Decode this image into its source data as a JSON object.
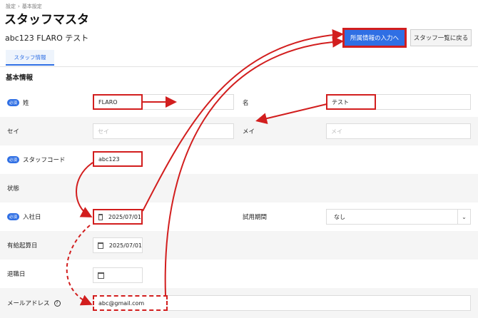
{
  "breadcrumb": {
    "parent": "設定",
    "separator": "›",
    "current": "基本設定"
  },
  "page": {
    "title": "スタッフマスタ",
    "staff_name": "abc123 FLARO テスト"
  },
  "buttons": {
    "to_affiliation": "所属情報の入力へ",
    "back_to_list": "スタッフ一覧に戻る"
  },
  "tabs": [
    {
      "label": "スタッフ情報"
    }
  ],
  "section": {
    "title": "基本情報"
  },
  "required_badge": "必須",
  "form": {
    "last_name": {
      "label": "姓",
      "value": "FLARO"
    },
    "first_name": {
      "label": "名",
      "value": "テスト"
    },
    "last_name_kana": {
      "label": "セイ",
      "placeholder": "セイ"
    },
    "first_name_kana": {
      "label": "メイ",
      "placeholder": "メイ"
    },
    "staff_code": {
      "label": "スタッフコード",
      "value": "abc123"
    },
    "status": {
      "label": "状態"
    },
    "hire_date": {
      "label": "入社日",
      "value": "2025/07/01"
    },
    "trial_period": {
      "label": "試用期間",
      "value": "なし"
    },
    "paid_leave_start": {
      "label": "有給起算日",
      "value": "2025/07/01"
    },
    "retire_date": {
      "label": "退職日",
      "value": ""
    },
    "email": {
      "label": "メールアドレス",
      "value": "abc@gmail.com"
    }
  },
  "colors": {
    "accent": "#2f6fe4",
    "annotation": "#d21e1e",
    "row_shade": "#f5f5f5"
  },
  "icons": {
    "calendar": "calendar-icon",
    "help": "help-circle-icon",
    "chevron": "chevron-down-icon"
  }
}
